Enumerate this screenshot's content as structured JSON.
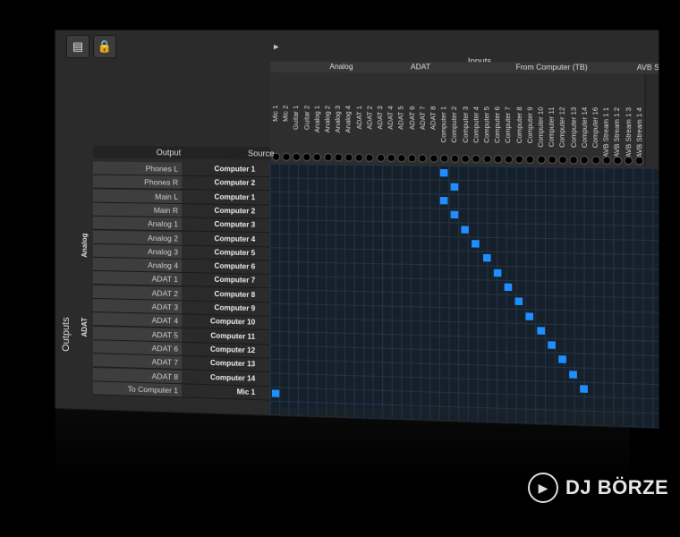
{
  "toolbar": {
    "icons": [
      "window-icon",
      "lock-icon"
    ]
  },
  "inputs_header": "Inputs",
  "input_groups": [
    "Analog",
    "ADAT",
    "From Computer (TB)",
    "AVB S"
  ],
  "input_columns": [
    "Mic 1",
    "Mic 2",
    "Guitar 1",
    "Guitar 2",
    "Analog 1",
    "Analog 2",
    "Analog 3",
    "Analog 4",
    "ADAT 1",
    "ADAT 2",
    "ADAT 3",
    "ADAT 4",
    "ADAT 5",
    "ADAT 6",
    "ADAT 7",
    "ADAT 8",
    "Computer 1",
    "Computer 2",
    "Computer 3",
    "Computer 4",
    "Computer 5",
    "Computer 6",
    "Computer 7",
    "Computer 8",
    "Computer 9",
    "Computer 10",
    "Computer 11",
    "Computer 12",
    "Computer 13",
    "Computer 14",
    "Computer 16",
    "AVB Stream 1 1",
    "AVB Stream 1 2",
    "AVB Stream 1 3",
    "AVB Stream 1 4"
  ],
  "table_header": {
    "output": "Output",
    "source": "Source"
  },
  "side_labels": {
    "outputs": "Outputs",
    "analog": "Analog",
    "adat": "ADAT"
  },
  "rows": [
    {
      "output": "Phones L",
      "source": "Computer 1",
      "col": 16
    },
    {
      "output": "Phones R",
      "source": "Computer 2",
      "col": 17
    },
    {
      "output": "Main L",
      "source": "Computer 1",
      "col": 16
    },
    {
      "output": "Main R",
      "source": "Computer 2",
      "col": 17
    },
    {
      "output": "Analog 1",
      "source": "Computer 3",
      "col": 18
    },
    {
      "output": "Analog 2",
      "source": "Computer 4",
      "col": 19
    },
    {
      "output": "Analog 3",
      "source": "Computer 5",
      "col": 20
    },
    {
      "output": "Analog 4",
      "source": "Computer 6",
      "col": 21
    },
    {
      "output": "ADAT 1",
      "source": "Computer 7",
      "col": 22
    },
    {
      "output": "ADAT 2",
      "source": "Computer 8",
      "col": 23
    },
    {
      "output": "ADAT 3",
      "source": "Computer 9",
      "col": 24
    },
    {
      "output": "ADAT 4",
      "source": "Computer 10",
      "col": 25
    },
    {
      "output": "ADAT 5",
      "source": "Computer 11",
      "col": 26
    },
    {
      "output": "ADAT 6",
      "source": "Computer 12",
      "col": 27
    },
    {
      "output": "ADAT 7",
      "source": "Computer 13",
      "col": 28
    },
    {
      "output": "ADAT 8",
      "source": "Computer 14",
      "col": 29
    },
    {
      "output": "To Computer 1",
      "source": "Mic 1",
      "col": 0
    }
  ],
  "logo": {
    "text": "DJ BÖRZE",
    "icon": "play-disc-icon"
  },
  "colors": {
    "accent": "#1f8fff",
    "grid_bg": "#15202b"
  }
}
